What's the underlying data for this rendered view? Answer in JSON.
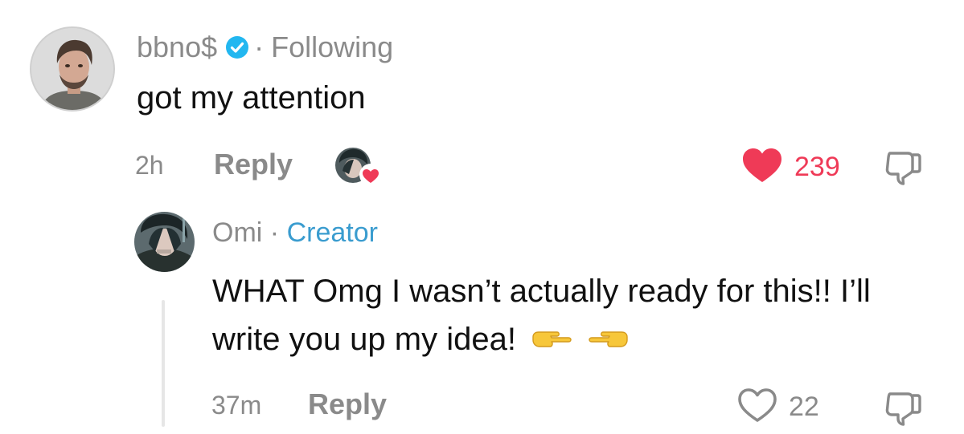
{
  "comment": {
    "username": "bbno$",
    "separator": "·",
    "follow_status": "Following",
    "text": "got my attention",
    "time": "2h",
    "reply_label": "Reply",
    "like_count": "239",
    "liked": true,
    "liked_by_creator": true
  },
  "reply": {
    "username": "Omi",
    "separator": "·",
    "badge": "Creator",
    "text": "WHAT Omg I wasn’t actually ready for this!! I’ll write you up my idea!",
    "emojis": [
      "pointing-right-emoji",
      "pointing-left-emoji"
    ],
    "time": "37m",
    "reply_label": "Reply",
    "like_count": "22",
    "liked": false
  },
  "colors": {
    "muted_text": "#8a8a8a",
    "like_red": "#ef3a57",
    "creator_blue": "#3a9ccf",
    "verified_blue": "#22b7f0",
    "thread_line": "#e6e6e6"
  },
  "icons": {
    "verified": "verified-badge-icon",
    "like_filled": "heart-filled-icon",
    "like_outline": "heart-outline-icon",
    "dislike": "thumbs-down-icon"
  }
}
